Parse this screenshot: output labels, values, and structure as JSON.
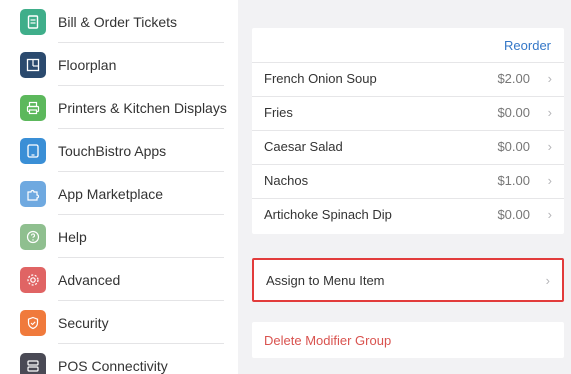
{
  "sidebar": {
    "items": [
      {
        "label": "Bill & Order Tickets",
        "icon": "receipt-icon",
        "color": "#3fae8a"
      },
      {
        "label": "Floorplan",
        "icon": "floorplan-icon",
        "color": "#2b4a6e"
      },
      {
        "label": "Printers & Kitchen Displays",
        "icon": "printer-icon",
        "color": "#5cb85c"
      },
      {
        "label": "TouchBistro Apps",
        "icon": "tablet-icon",
        "color": "#3a8fd6"
      },
      {
        "label": "App Marketplace",
        "icon": "puzzle-icon",
        "color": "#6fa9e0"
      },
      {
        "label": "Help",
        "icon": "help-icon",
        "color": "#8fbf8f"
      },
      {
        "label": "Advanced",
        "icon": "gear-icon",
        "color": "#e06464"
      },
      {
        "label": "Security",
        "icon": "shield-icon",
        "color": "#f07a3c"
      },
      {
        "label": "POS Connectivity",
        "icon": "server-icon",
        "color": "#4a4a55"
      }
    ]
  },
  "main": {
    "reorder_label": "Reorder",
    "items": [
      {
        "name": "French Onion Soup",
        "price": "$2.00"
      },
      {
        "name": "Fries",
        "price": "$0.00"
      },
      {
        "name": "Caesar Salad",
        "price": "$0.00"
      },
      {
        "name": "Nachos",
        "price": "$1.00"
      },
      {
        "name": "Artichoke Spinach Dip",
        "price": "$0.00"
      }
    ],
    "assign_label": "Assign to Menu Item",
    "delete_label": "Delete Modifier Group",
    "chevron": "›"
  },
  "colors": {
    "accent": "#3477c7",
    "highlight_border": "#e23b3b",
    "destructive": "#d9534f"
  }
}
